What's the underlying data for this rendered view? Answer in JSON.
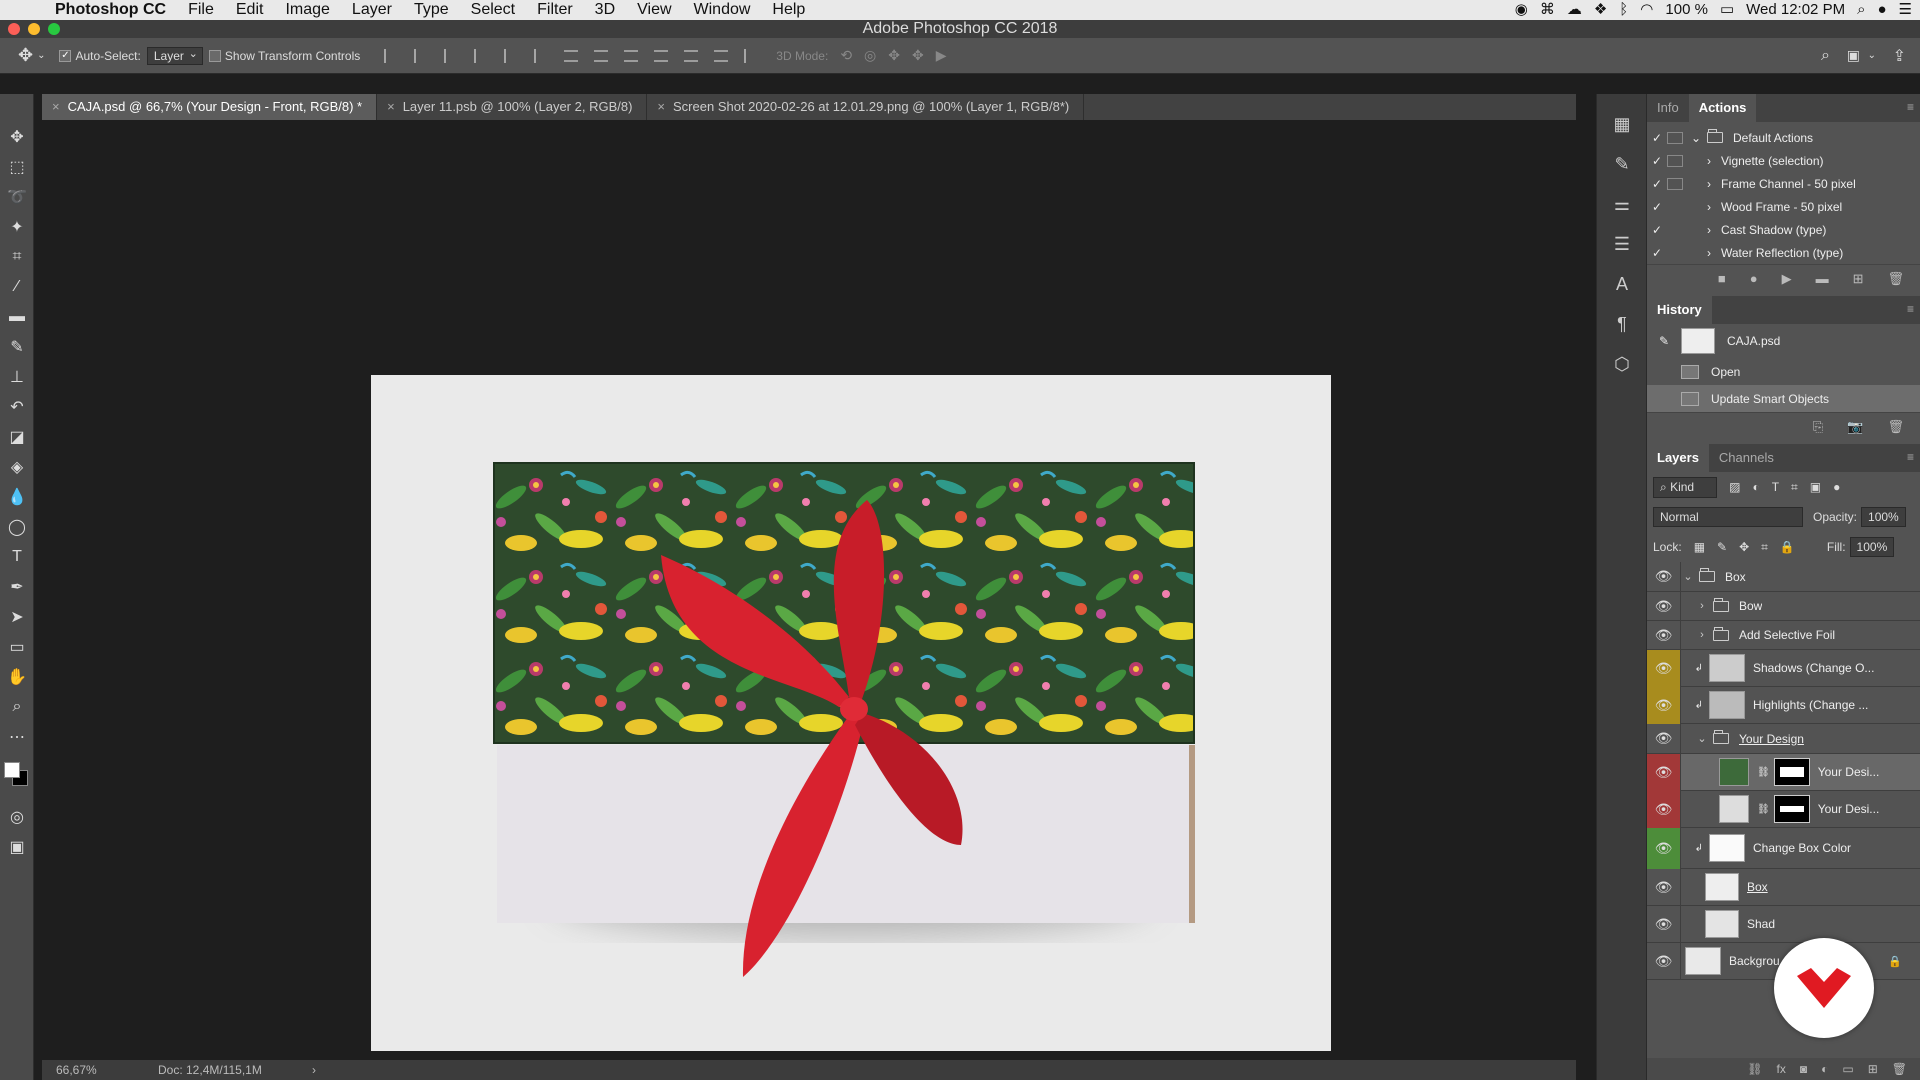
{
  "menubar": {
    "apple_icon": "apple-icon",
    "app": "Photoshop CC",
    "items": [
      "File",
      "Edit",
      "Image",
      "Layer",
      "Type",
      "Select",
      "Filter",
      "3D",
      "View",
      "Window",
      "Help"
    ],
    "battery": "100 %",
    "clock": "Wed 12:02 PM"
  },
  "titlebar": {
    "title": "Adobe Photoshop CC 2018"
  },
  "options": {
    "auto_select_label": "Auto-Select:",
    "auto_select_value": "Layer",
    "show_transform_label": "Show Transform Controls",
    "mode_3d_label": "3D Mode:"
  },
  "tabs": [
    {
      "label": "CAJA.psd @ 66,7% (Your Design - Front, RGB/8) *",
      "active": true
    },
    {
      "label": "Layer 11.psb @ 100% (Layer 2, RGB/8)",
      "active": false
    },
    {
      "label": "Screen Shot 2020-02-26 at 12.01.29.png @ 100% (Layer 1, RGB/8*)",
      "active": false
    }
  ],
  "status": {
    "zoom": "66,67%",
    "doc": "Doc: 12,4M/115,1M"
  },
  "actions_panel": {
    "tabs": [
      "Info",
      "Actions"
    ],
    "active_tab": "Actions",
    "items": [
      {
        "label": "Default Actions",
        "type": "folder"
      },
      {
        "label": "Vignette (selection)",
        "type": "action"
      },
      {
        "label": "Frame Channel - 50 pixel",
        "type": "action"
      },
      {
        "label": "Wood Frame - 50 pixel",
        "type": "action"
      },
      {
        "label": "Cast Shadow (type)",
        "type": "action"
      },
      {
        "label": "Water Reflection (type)",
        "type": "action"
      }
    ]
  },
  "history_panel": {
    "title": "History",
    "snapshot": "CAJA.psd",
    "states": [
      {
        "label": "Open",
        "selected": false
      },
      {
        "label": "Update Smart Objects",
        "selected": true
      }
    ]
  },
  "layers_panel": {
    "tabs": [
      "Layers",
      "Channels"
    ],
    "active_tab": "Layers",
    "filter_label": "Kind",
    "blend_mode": "Normal",
    "opacity_label": "Opacity:",
    "opacity": "100%",
    "lock_label": "Lock:",
    "fill_label": "Fill:",
    "fill": "100%",
    "layers": [
      {
        "name": "Box",
        "kind": "group-open",
        "indent": 0,
        "eye": "none"
      },
      {
        "name": "Bow",
        "kind": "group-closed",
        "indent": 1,
        "eye": "none"
      },
      {
        "name": "Add Selective Foil",
        "kind": "group-closed",
        "indent": 1,
        "eye": "none"
      },
      {
        "name": "Shadows (Change O...",
        "kind": "smart",
        "indent": 1,
        "eye": "yellow"
      },
      {
        "name": "Highlights (Change ...",
        "kind": "smart",
        "indent": 1,
        "eye": "yellow"
      },
      {
        "name": "Your Design",
        "kind": "group-open",
        "indent": 1,
        "eye": "none"
      },
      {
        "name": "Your Desi...",
        "kind": "masked",
        "indent": 2,
        "eye": "red",
        "selected": true
      },
      {
        "name": "Your Desi...",
        "kind": "masked",
        "indent": 2,
        "eye": "red"
      },
      {
        "name": "Change Box Color",
        "kind": "smart",
        "indent": 1,
        "eye": "green"
      },
      {
        "name": "Box",
        "kind": "smart",
        "indent": 1,
        "eye": "none"
      },
      {
        "name": "Shad",
        "kind": "smart",
        "indent": 1,
        "eye": "none"
      },
      {
        "name": "Backgrou",
        "kind": "background",
        "indent": 0,
        "eye": "none"
      }
    ]
  },
  "colors": {
    "ribbon": "#d8222f",
    "eye_yellow": "#a88c1e",
    "eye_red": "#a23838",
    "eye_green": "#4d8d3a"
  }
}
